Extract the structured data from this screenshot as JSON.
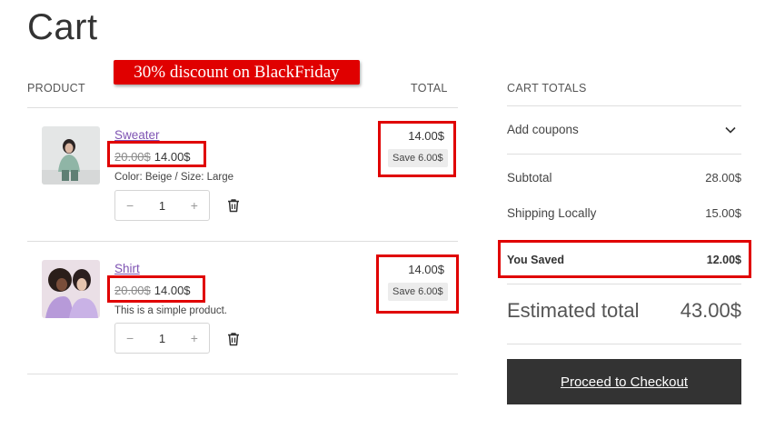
{
  "page": {
    "title": "Cart"
  },
  "table": {
    "product_header": "PRODUCT",
    "total_header": "TOTAL"
  },
  "promo_banner": "30% discount on BlackFriday",
  "items": [
    {
      "name": "Sweater",
      "old_price": "20.00$",
      "price": "14.00$",
      "description": "Color: Beige / Size: Large",
      "quantity": "1",
      "total": "14.00$",
      "save": "Save 6.00$"
    },
    {
      "name": "Shirt",
      "old_price": "20.00$",
      "price": "14.00$",
      "description": "This is a simple product.",
      "quantity": "1",
      "total": "14.00$",
      "save": "Save 6.00$"
    }
  ],
  "qty_controls": {
    "minus": "−",
    "plus": "+"
  },
  "totals": {
    "header": "CART TOTALS",
    "coupons_label": "Add coupons",
    "subtotal_label": "Subtotal",
    "subtotal_value": "28.00$",
    "shipping_label": "Shipping Locally",
    "shipping_value": "15.00$",
    "saved_label": "You Saved",
    "saved_value": "12.00$",
    "estimated_label": "Estimated total",
    "estimated_value": "43.00$",
    "checkout_label": "Proceed to Checkout"
  },
  "colors": {
    "highlight_red": "#e00000",
    "link_purple": "#7f54b3",
    "button_dark": "#333333"
  }
}
